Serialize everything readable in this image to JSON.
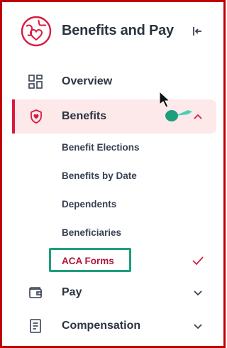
{
  "header": {
    "title": "Benefits and Pay",
    "logo_icon": "globe-heart-icon",
    "collapse_icon": "collapse-left-icon"
  },
  "nav": {
    "overview": {
      "label": "Overview",
      "icon": "dashboard-grid-icon"
    },
    "benefits": {
      "label": "Benefits",
      "icon": "shield-heart-icon",
      "expanded": true,
      "sub_items": [
        {
          "label": "Benefit Elections"
        },
        {
          "label": "Benefits by Date"
        },
        {
          "label": "Dependents"
        },
        {
          "label": "Beneficiaries"
        },
        {
          "label": "ACA Forms",
          "selected": true
        }
      ]
    },
    "pay": {
      "label": "Pay",
      "icon": "wallet-icon"
    },
    "compensation": {
      "label": "Compensation",
      "icon": "document-icon"
    }
  },
  "colors": {
    "accent": "#d81b3f",
    "active_bg": "#fde8ea",
    "frame": "#c00000",
    "highlight": "#1f9e7c",
    "text": "#2b3440"
  }
}
